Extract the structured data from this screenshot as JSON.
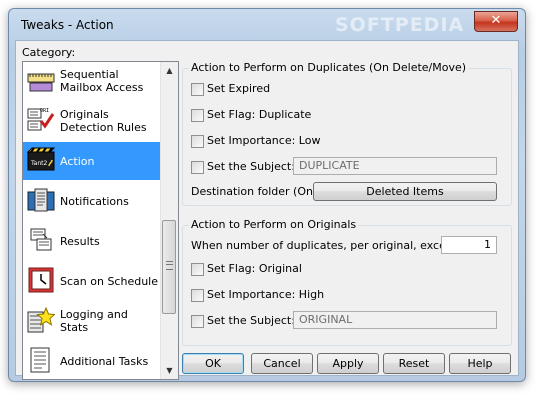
{
  "window": {
    "title": "Tweaks - Action",
    "watermark": "SOFTPEDIA",
    "close_glyph": "✕"
  },
  "sidebar": {
    "label": "Category:",
    "items": [
      {
        "label": "Sequential Mailbox Access",
        "icon": "mailbox-icon",
        "selected": false
      },
      {
        "label": "Originals Detection Rules",
        "icon": "checkmark-document-icon",
        "selected": false
      },
      {
        "label": "Action",
        "icon": "clapperboard-icon",
        "selected": true
      },
      {
        "label": "Notifications",
        "icon": "notification-icon",
        "selected": false
      },
      {
        "label": "Results",
        "icon": "results-icon",
        "selected": false
      },
      {
        "label": "Scan on Schedule",
        "icon": "schedule-icon",
        "selected": false
      },
      {
        "label": "Logging and Stats",
        "icon": "logging-icon",
        "selected": false
      },
      {
        "label": "Additional Tasks",
        "icon": "tasks-icon",
        "selected": false
      }
    ]
  },
  "duplicates_group": {
    "title": "Action to Perform on Duplicates (On Delete/Move)",
    "set_expired": "Set Expired",
    "set_flag": "Set Flag: Duplicate",
    "set_importance": "Set Importance: Low",
    "set_subject": "Set the Subject:",
    "subject_value": "DUPLICATE",
    "destination_label": "Destination folder (On move):",
    "destination_button": "Deleted Items"
  },
  "originals_group": {
    "title": "Action to Perform on Originals",
    "exceeds_label": "When number of duplicates, per original, exceeds:",
    "exceeds_value": "1",
    "set_flag": "Set Flag: Original",
    "set_importance": "Set Importance: High",
    "set_subject": "Set the Subject:",
    "subject_value": "ORIGINAL"
  },
  "buttons": {
    "ok": "OK",
    "cancel": "Cancel",
    "apply": "Apply",
    "reset": "Reset",
    "help": "Help"
  },
  "colors": {
    "selection": "#3399ff",
    "dialog_face": "#f0f0f0",
    "frame": "#c3d6ea"
  }
}
